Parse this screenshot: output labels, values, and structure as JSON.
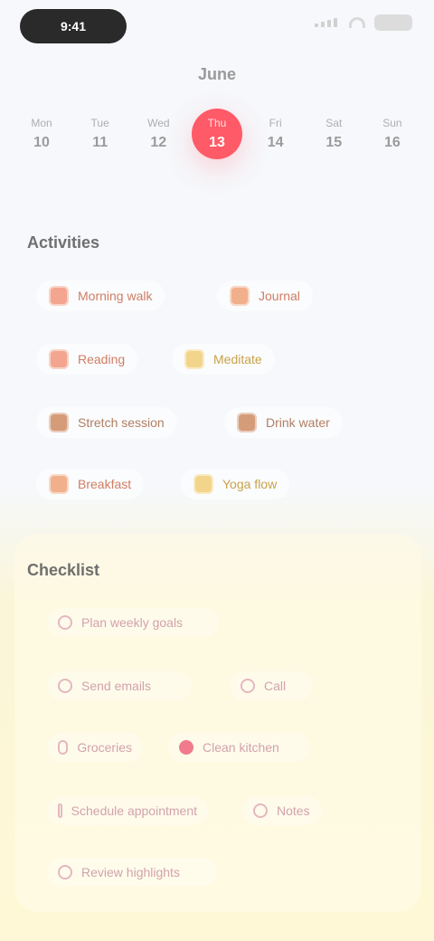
{
  "status_bar": {
    "time": "9:41"
  },
  "calendar": {
    "month": "June",
    "days": [
      {
        "dow": "Mon",
        "date": "10"
      },
      {
        "dow": "Tue",
        "date": "11"
      },
      {
        "dow": "Wed",
        "date": "12"
      },
      {
        "dow": "Thu",
        "date": "13"
      },
      {
        "dow": "Fri",
        "date": "14"
      },
      {
        "dow": "Sat",
        "date": "15"
      },
      {
        "dow": "Sun",
        "date": "16"
      }
    ],
    "selected_index": 3
  },
  "sections": {
    "first_title": "Activities",
    "second_title": "Checklist"
  },
  "activities": [
    {
      "label": "Morning walk"
    },
    {
      "label": "Journal"
    },
    {
      "label": "Reading"
    },
    {
      "label": "Meditate"
    },
    {
      "label": "Stretch session"
    },
    {
      "label": "Drink water"
    },
    {
      "label": "Breakfast"
    },
    {
      "label": "Yoga flow"
    }
  ],
  "checklist": [
    {
      "label": "Plan weekly goals"
    },
    {
      "label": "Send emails"
    },
    {
      "label": "Call"
    },
    {
      "label": "Groceries"
    },
    {
      "label": "Clean kitchen"
    },
    {
      "label": "Schedule appointment"
    },
    {
      "label": "Notes"
    },
    {
      "label": "Review highlights"
    }
  ],
  "colors": {
    "accent_red": "#ff5a67",
    "card_bg": "#fff8d6"
  }
}
